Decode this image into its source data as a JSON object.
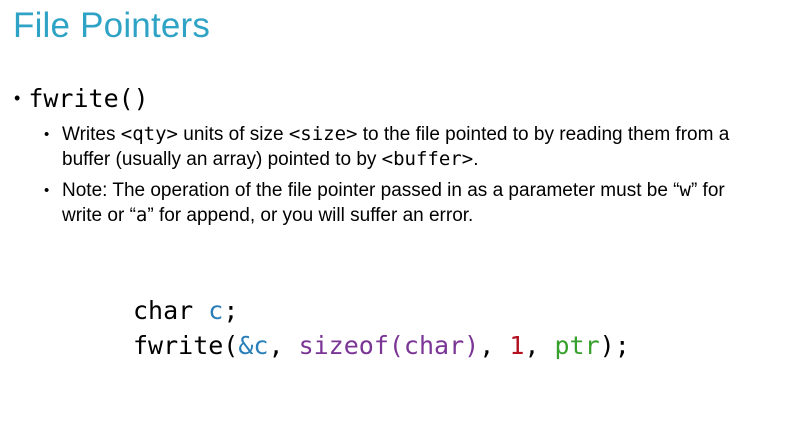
{
  "slide": {
    "title": "File Pointers",
    "bullet1": {
      "label": "fwrite()"
    },
    "bullet2": {
      "prefix": "Writes ",
      "qty": "<qty>",
      "mid1": " units of size ",
      "size": "<size>",
      "mid2": " to the file pointed to by reading them from a buffer (usually an array) pointed to by ",
      "buffer": "<buffer>",
      "suffix": "."
    },
    "bullet3": {
      "prefix": "Note: The operation of the file pointer passed in as a parameter must be “",
      "w": "w",
      "mid": "” for write or “",
      "a": "a",
      "suffix": "” for append, or you will suffer an error."
    },
    "code": {
      "line1": {
        "type": "char",
        "space": " ",
        "var": "c",
        "semi": ";"
      },
      "line2": {
        "fn": "fwrite(",
        "arg1": "&c",
        "sep1": ", ",
        "arg2": "sizeof(char)",
        "sep2": ", ",
        "arg3": "1",
        "sep3": ", ",
        "arg4": "ptr",
        "end": ");"
      }
    }
  },
  "colors": {
    "title": "#2ea3c6",
    "blue": "#2a7fb9",
    "purple": "#7a3595",
    "red": "#b30f1f",
    "green": "#38a02d"
  }
}
